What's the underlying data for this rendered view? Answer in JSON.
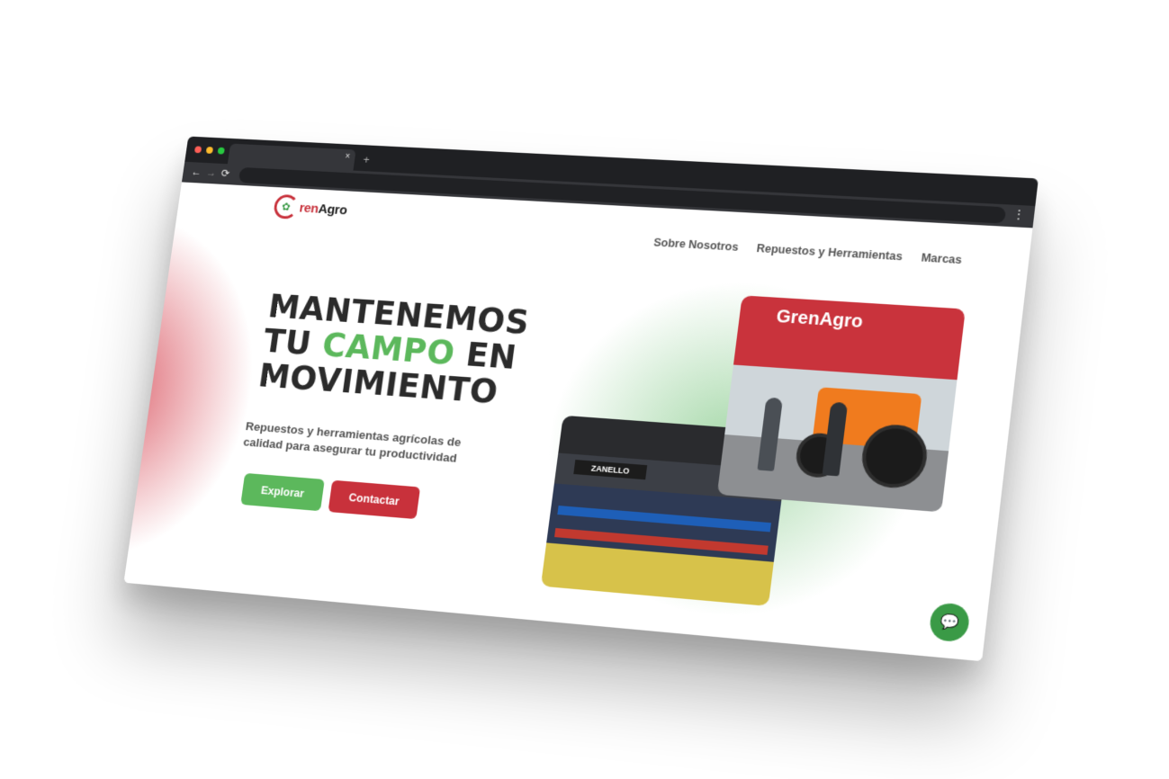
{
  "browser": {
    "tab_close": "×",
    "tab_new": "+",
    "back": "←",
    "forward": "→",
    "reload": "⟳",
    "menu": "⋮"
  },
  "brand": {
    "logo_prefix": "ren",
    "logo_suffix": "Agro",
    "colors": {
      "red": "#c8313b",
      "green": "#5cb85c"
    }
  },
  "nav": {
    "items": [
      "Sobre Nosotros",
      "Repuestos y Herramientas",
      "Marcas"
    ]
  },
  "hero": {
    "line1": "MANTENEMOS",
    "line2_a": "TU ",
    "line2_accent": "CAMPO",
    "line2_b": " EN",
    "line3": "MOVIMIENTO",
    "subtitle": "Repuestos y herramientas agrícolas de calidad para asegurar tu productividad",
    "buttons": {
      "explore": "Explorar",
      "contact": "Contactar"
    }
  },
  "photos": {
    "store_brand": "ZANELLO",
    "store_sign": "GrenAgro"
  },
  "chat": {
    "icon": "chat-bubble-icon"
  }
}
